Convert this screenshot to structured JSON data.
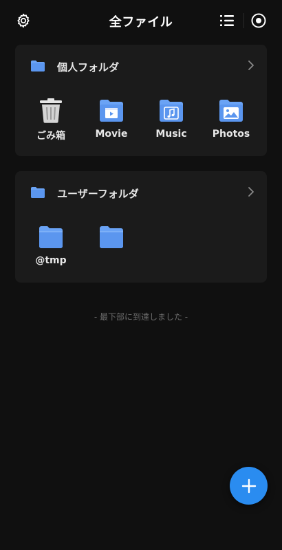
{
  "header": {
    "title": "全ファイル",
    "settings_icon": "gear-icon",
    "list_icon": "list-view-icon",
    "select_icon": "select-circle-icon"
  },
  "personal": {
    "label": "個人フォルダ",
    "items": [
      {
        "label": "ごみ箱",
        "icon": "trash-icon"
      },
      {
        "label": "Movie",
        "icon": "movie-folder-icon"
      },
      {
        "label": "Music",
        "icon": "music-folder-icon"
      },
      {
        "label": "Photos",
        "icon": "photos-folder-icon"
      }
    ]
  },
  "user": {
    "label": "ユーザーフォルダ",
    "items": [
      {
        "label": "@tmp",
        "icon": "folder-icon"
      },
      {
        "label": "",
        "icon": "folder-icon"
      }
    ]
  },
  "end_text": "- 最下部に到達しました -",
  "colors": {
    "accent": "#2a8cf0",
    "folder": "#6aa3f5",
    "card": "#1b1b1b",
    "background": "#101010"
  }
}
